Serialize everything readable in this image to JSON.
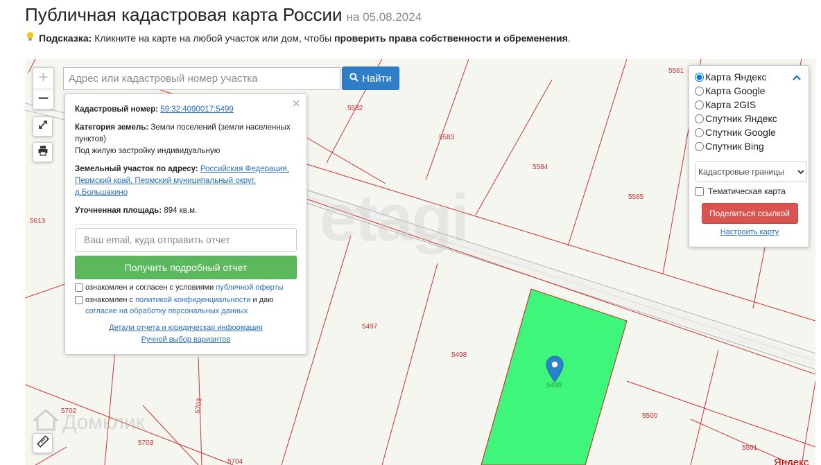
{
  "header": {
    "title": "Публичная кадастровая карта России",
    "date": "на 05.08.2024"
  },
  "hint": {
    "label": "Подсказка:",
    "text": "Кликните на карте на любой участок или дом, чтобы",
    "bold": "проверить права собственности и обременения",
    "end": "."
  },
  "search": {
    "placeholder": "Адрес или кадастровый номер участка",
    "button_label": "Найти"
  },
  "zoom": {
    "in": "+",
    "out": "−"
  },
  "popup": {
    "cadastral_label": "Кадастровый номер:",
    "cadastral_value": "59:32:4090017:5499",
    "category_label": "Категория земель:",
    "category_value": "Земли поселений (земли населенных пунктов)",
    "usage": "Под жилую застройку индивидуальную",
    "address_label": "Земельный участок по адресу:",
    "address_value": "Российская Федерация, Пермский край, Пермский муниципальный округ, д.Большакино",
    "area_label": "Уточненная площадь:",
    "area_value": "894 кв.м.",
    "email_placeholder": "Ваш email, куда отправить отчет",
    "report_button": "Получить подробный отчет",
    "agree1_text": "ознакомлен и согласен с условиями",
    "agree1_link": "публичной оферты",
    "agree2_text": "ознакомлен с",
    "agree2_link": "политикой конфиденциальности",
    "agree2_mid": "и даю",
    "agree2_link2": "согласие на обработку персональных данных",
    "details_link": "Детали отчета и юридическая информация",
    "manual_link": "Ручной выбор вариантов"
  },
  "layers": {
    "options": [
      "Карта Яндекс",
      "Карта Google",
      "Карта 2GIS",
      "Спутник Яндекс",
      "Спутник Google",
      "Спутник Bing"
    ],
    "selected": "Карта Яндекс",
    "overlay_select": "Кадастровые границы",
    "thematic_label": "Тематическая карта",
    "share_button": "Поделиться ссылкой",
    "configure_link": "Настроить карту"
  },
  "parcels": {
    "5561": "5561",
    "5582": "5582",
    "5583": "5583",
    "5584": "5584",
    "5585": "5585",
    "5613": "5613",
    "5497": "5497",
    "5498": "5498",
    "5499": "5499",
    "5500": "5500",
    "5501": "5501",
    "5702": "5702",
    "5703a": "5703",
    "5703b": "5703",
    "5704": "5704"
  },
  "watermarks": {
    "etagi": "etagi",
    "domclick": "Домклик",
    "provider": "Яндекс"
  },
  "colors": {
    "parcel_line": "#d03030",
    "selected_parcel": "#3ef77a",
    "marker": "#2b82cb",
    "search_button": "#2f7dc4",
    "report_button": "#5cb85c",
    "share_button": "#d9534f"
  }
}
